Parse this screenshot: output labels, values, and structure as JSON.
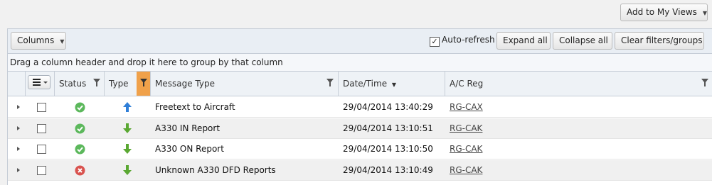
{
  "top": {
    "add_views_label": "Add to My Views"
  },
  "toolbar": {
    "columns_label": "Columns",
    "autorefresh_label": "Auto-refresh",
    "autorefresh_checked": true,
    "expand_label": "Expand all",
    "collapse_label": "Collapse all",
    "clear_label": "Clear filters/groups"
  },
  "groupbar": {
    "hint": "Drag a column header and drop it here to group by that column"
  },
  "columns": {
    "status": "Status",
    "type": "Type",
    "message_type": "Message Type",
    "datetime": "Date/Time",
    "ac_reg": "A/C Reg"
  },
  "rows": [
    {
      "status": "success",
      "direction": "up",
      "message_type": "Freetext to Aircraft",
      "datetime": "29/04/2014 13:40:29",
      "ac_reg": "RG-CAX"
    },
    {
      "status": "success",
      "direction": "down",
      "message_type": "A330 IN Report",
      "datetime": "29/04/2014 13:10:51",
      "ac_reg": "RG-CAK"
    },
    {
      "status": "success",
      "direction": "down",
      "message_type": "A330 ON Report",
      "datetime": "29/04/2014 13:10:50",
      "ac_reg": "RG-CAK"
    },
    {
      "status": "error",
      "direction": "down",
      "message_type": "Unknown A330 DFD Reports",
      "datetime": "29/04/2014 13:10:49",
      "ac_reg": "RG-CAK"
    }
  ],
  "colors": {
    "success": "#5cb85c",
    "error": "#d9534f",
    "up_arrow": "#2f7fd8",
    "down_arrow": "#5aa832",
    "filter_active": "#f0a14a"
  },
  "icons": {
    "status_success": "check-circle-icon",
    "status_error": "x-circle-icon",
    "direction_up": "arrow-up-icon",
    "direction_down": "arrow-down-icon"
  }
}
